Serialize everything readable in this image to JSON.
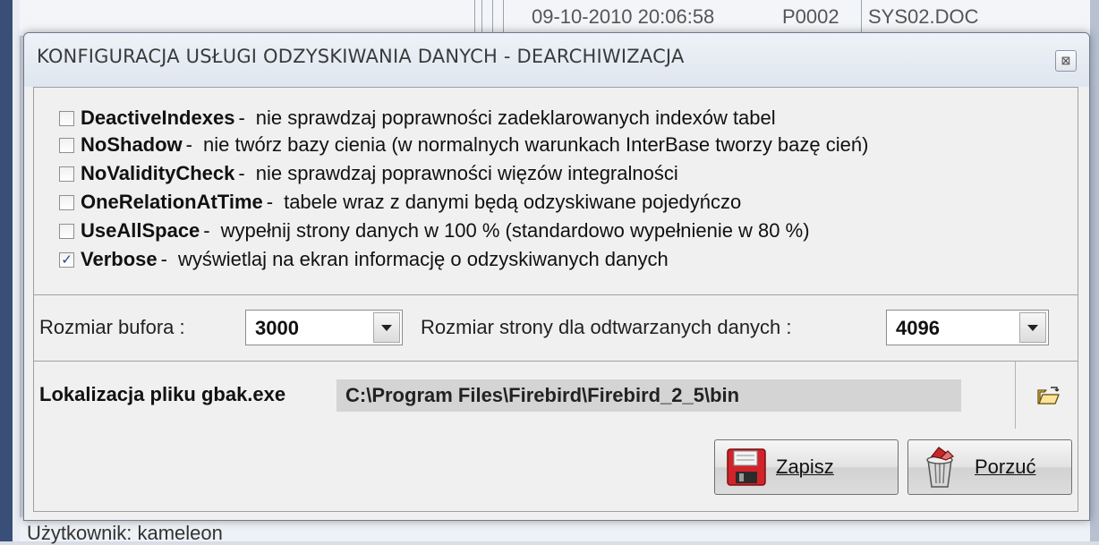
{
  "background": {
    "top_row_date": "09-10-2010 20:06:58",
    "top_row_code": "P0002",
    "top_row_file": "SYS02.DOC",
    "status_user": "Użytkownik: kameleon"
  },
  "dialog": {
    "title": "KONFIGURACJA USŁUGI ODZYSKIWANIA DANYCH - DEARCHIWIZACJA",
    "close_glyph": "⊠"
  },
  "options": [
    {
      "name": "DeactiveIndexes",
      "sep": "-",
      "desc": "nie sprawdzaj poprawności zadeklarowanych indexów tabel",
      "checked": false
    },
    {
      "name": "NoShadow",
      "sep": "-",
      "desc": "nie twórz bazy cienia (w normalnych warunkach InterBase tworzy bazę cień)",
      "checked": false
    },
    {
      "name": "NoValidityCheck",
      "sep": "-",
      "desc": "nie sprawdzaj poprawności więzów integralności",
      "checked": false
    },
    {
      "name": "OneRelationAtTime",
      "sep": "-",
      "desc": "tabele wraz z danymi będą odzyskiwane pojedyńczo",
      "checked": false
    },
    {
      "name": "UseAllSpace",
      "sep": "-",
      "desc": "wypełnij strony danych w 100 % (standardowo wypełnienie w 80 %)",
      "checked": false
    },
    {
      "name": "Verbose",
      "sep": "-",
      "desc": "wyświetlaj na ekran informację o odzyskiwanych danych",
      "checked": true
    }
  ],
  "sizes": {
    "buffer_label": "Rozmiar bufora :",
    "buffer_value": "3000",
    "page_label": "Rozmiar strony dla odtwarzanych danych :",
    "page_value": "4096"
  },
  "path": {
    "label": "Lokalizacja pliku gbak.exe",
    "value": "C:\\Program Files\\Firebird\\Firebird_2_5\\bin"
  },
  "actions": {
    "save_label": "Zapisz",
    "cancel_label": "Porzuć"
  },
  "icons": {
    "check": "✓",
    "folder": "folder-open-icon",
    "save": "floppy-disk-icon",
    "cancel": "trash-bin-icon"
  }
}
